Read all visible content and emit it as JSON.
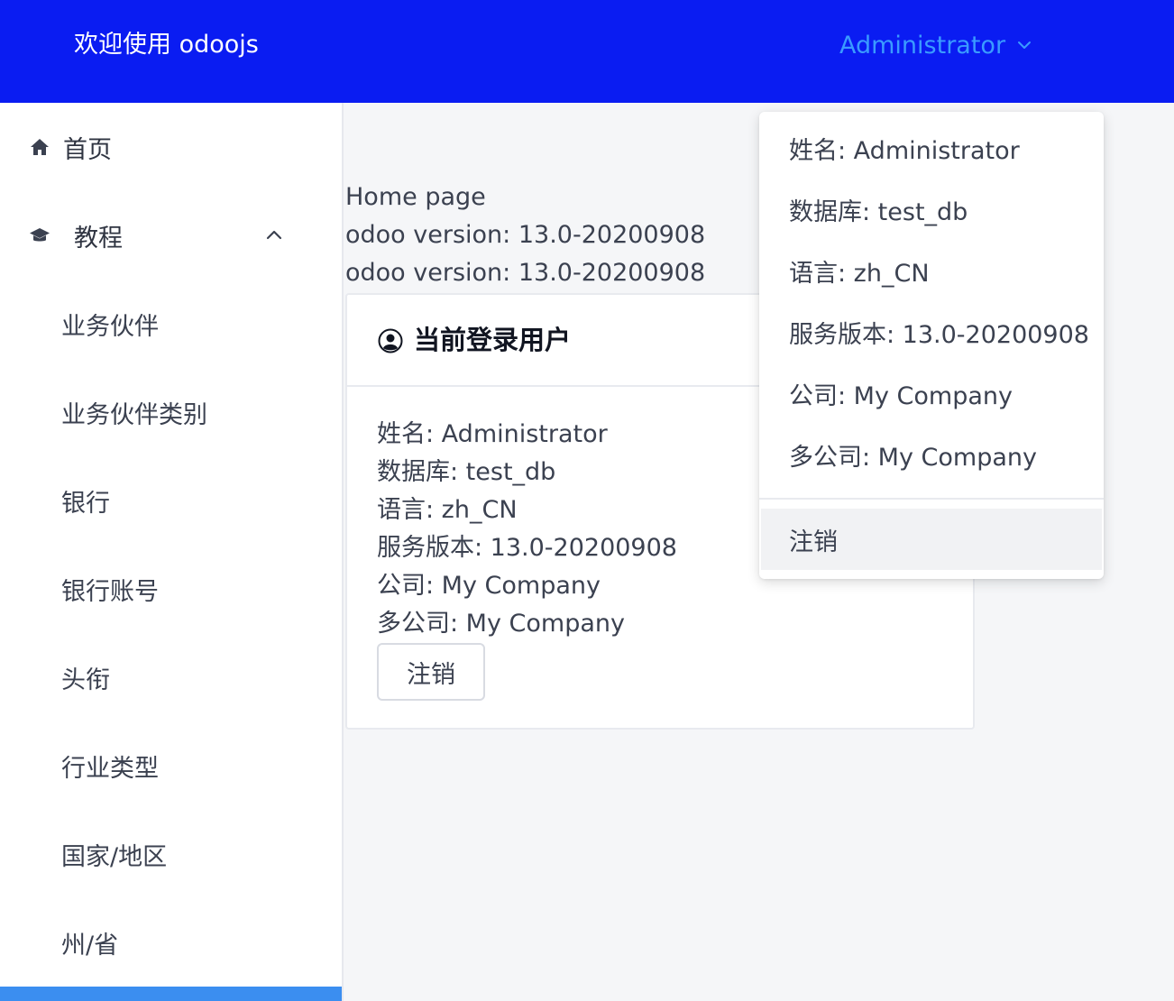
{
  "header": {
    "title": "欢迎使用 odoojs",
    "user_menu_label": "Administrator",
    "background": "#0a1cf2",
    "user_menu_color": "#3a9bff"
  },
  "sidebar": {
    "home": {
      "label": "首页",
      "icon": "home-icon"
    },
    "tutorial": {
      "label": "教程",
      "icon": "graduation-cap-icon",
      "expanded": true,
      "items": [
        {
          "label": "业务伙伴"
        },
        {
          "label": "业务伙伴类别"
        },
        {
          "label": "银行"
        },
        {
          "label": "银行账号"
        },
        {
          "label": "头衔"
        },
        {
          "label": "行业类型"
        },
        {
          "label": "国家/地区"
        },
        {
          "label": "州/省"
        }
      ]
    },
    "active_color": "#3b8ef0"
  },
  "main": {
    "lines": [
      "Home page",
      "odoo version: 13.0-20200908",
      "odoo version: 13.0-20200908"
    ],
    "card": {
      "title": "当前登录用户",
      "icon": "user-circle-icon",
      "fields": [
        "姓名: Administrator",
        "数据库: test_db",
        "语言: zh_CN",
        "服务版本: 13.0-20200908",
        "公司: My Company",
        "多公司: My Company"
      ],
      "logout_label": "注销"
    }
  },
  "dropdown": {
    "items": [
      "姓名: Administrator",
      "数据库: test_db",
      "语言: zh_CN",
      "服务版本: 13.0-20200908",
      "公司: My Company",
      "多公司: My Company"
    ],
    "logout_label": "注销"
  }
}
